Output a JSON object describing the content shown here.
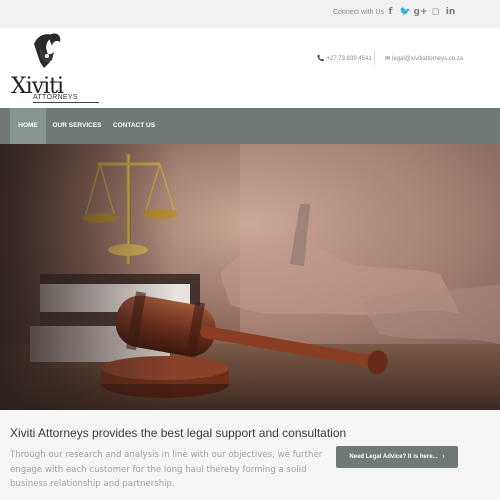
{
  "topbar": {
    "connect_label": "Connect with Us",
    "social": [
      {
        "icon": "facebook-icon",
        "glyph": "f"
      },
      {
        "icon": "twitter-icon",
        "glyph": "🐦"
      },
      {
        "icon": "google-plus-icon",
        "glyph": "g+"
      },
      {
        "icon": "instagram-icon",
        "glyph": "◻"
      },
      {
        "icon": "linkedin-icon",
        "glyph": "in"
      }
    ]
  },
  "header": {
    "logo_word": "Xiviti",
    "logo_sub": "ATTORNEYS",
    "phone_icon": "📞",
    "phone": "+27 73 839 4541",
    "email_icon": "✉",
    "email": "legal@xivitiattorneys.co.za"
  },
  "nav": {
    "items": [
      "HOME",
      "OUR SERVICES",
      "CONTACT US"
    ],
    "active": "HOME"
  },
  "intro": {
    "heading": "Xiviti Attorneys provides the best legal support and consultation",
    "body": "Through our research and analysis in line with our objectives, we further engage with each customer for the long haul thereby forming a solid business relationship and partnership.",
    "cta_label": "Need Legal Advice? It is here...",
    "cta_chevron": "›"
  },
  "colors": {
    "nav_bg": "#6f7a77",
    "nav_active": "#869490",
    "cta_bg": "#6f7a77"
  }
}
